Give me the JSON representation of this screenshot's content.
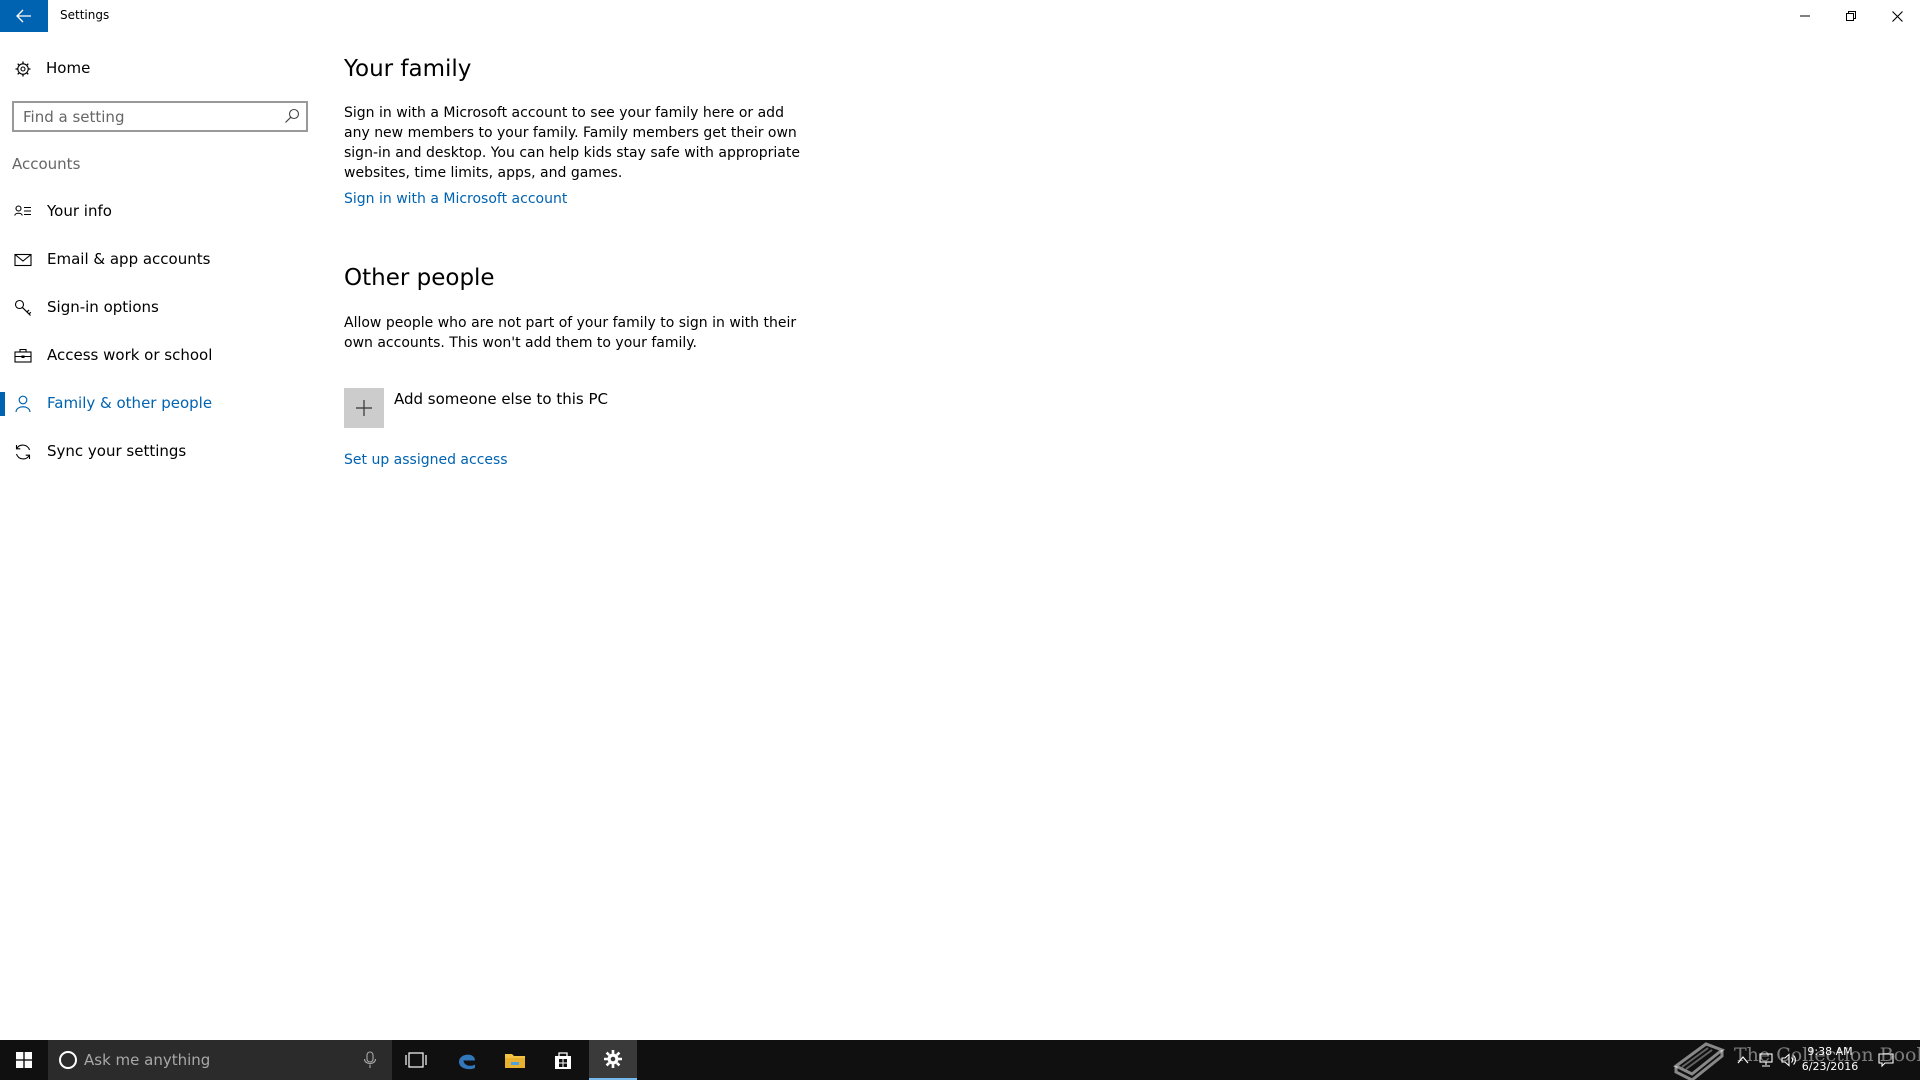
{
  "window": {
    "title": "Settings",
    "accent_color": "#0063b1"
  },
  "titlebar": {
    "back_icon": "back-arrow-icon",
    "minimize_icon": "minimize-icon",
    "maximize_icon": "restore-icon",
    "close_icon": "close-icon"
  },
  "sidebar": {
    "home_label": "Home",
    "search_placeholder": "Find a setting",
    "search_value": "",
    "section_label": "Accounts",
    "items": [
      {
        "label": "Your info",
        "icon": "contact-card-icon",
        "active": false
      },
      {
        "label": "Email & app accounts",
        "icon": "mail-icon",
        "active": false
      },
      {
        "label": "Sign-in options",
        "icon": "key-icon",
        "active": false
      },
      {
        "label": "Access work or school",
        "icon": "briefcase-icon",
        "active": false
      },
      {
        "label": "Family & other people",
        "icon": "person-icon",
        "active": true
      },
      {
        "label": "Sync your settings",
        "icon": "sync-icon",
        "active": false
      }
    ]
  },
  "main": {
    "family": {
      "title": "Your family",
      "description": "Sign in with a Microsoft account to see your family here or add any new members to your family. Family members get their own sign-in and desktop. You can help kids stay safe with appropriate websites, time limits, apps, and games.",
      "link": "Sign in with a Microsoft account"
    },
    "other": {
      "title": "Other people",
      "description": "Allow people who are not part of your family to sign in with their own accounts. This won't add them to your family.",
      "add_label": "Add someone else to this PC",
      "link": "Set up assigned access"
    }
  },
  "taskbar": {
    "search_placeholder": "Ask me anything",
    "apps": [
      {
        "name": "task-view",
        "icon": "task-view-icon",
        "active": false
      },
      {
        "name": "edge",
        "icon": "edge-icon",
        "active": false
      },
      {
        "name": "file-explorer",
        "icon": "folder-icon",
        "active": false
      },
      {
        "name": "store",
        "icon": "store-icon",
        "active": false
      },
      {
        "name": "settings",
        "icon": "gear-icon",
        "active": true
      }
    ],
    "time": "9:38 AM",
    "date": "6/23/2016",
    "watermark": "The Collection Book"
  }
}
